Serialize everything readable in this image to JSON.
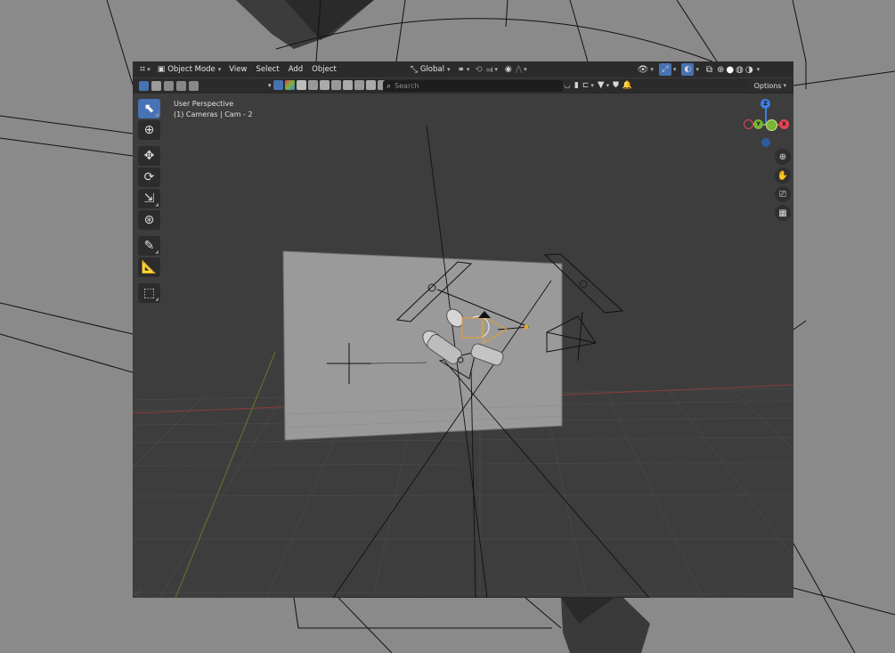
{
  "header": {
    "mode_label": "Object Mode",
    "menus": [
      "View",
      "Select",
      "Add",
      "Object"
    ],
    "transform_orientation": "Global"
  },
  "header2": {
    "search_placeholder": "Search",
    "options_label": "Options"
  },
  "overlay": {
    "view_name": "User Perspective",
    "active_object": "(1) Cameras | Cam - 2"
  },
  "gizmo": {
    "z": "Z",
    "y": "Y",
    "x": "X"
  },
  "colors": {
    "accent": "#4772b3",
    "x_axis": "#e24656",
    "y_axis": "#7ab337",
    "z_axis": "#3d7de0",
    "viewport_bg": "#3d3d3d",
    "desktop_bg": "#8a8a8a"
  },
  "tools": [
    "select-box-icon",
    "cursor-icon",
    "move-icon",
    "rotate-icon",
    "scale-icon",
    "transform-icon",
    "annotate-icon",
    "measure-icon",
    "add-cube-icon"
  ]
}
